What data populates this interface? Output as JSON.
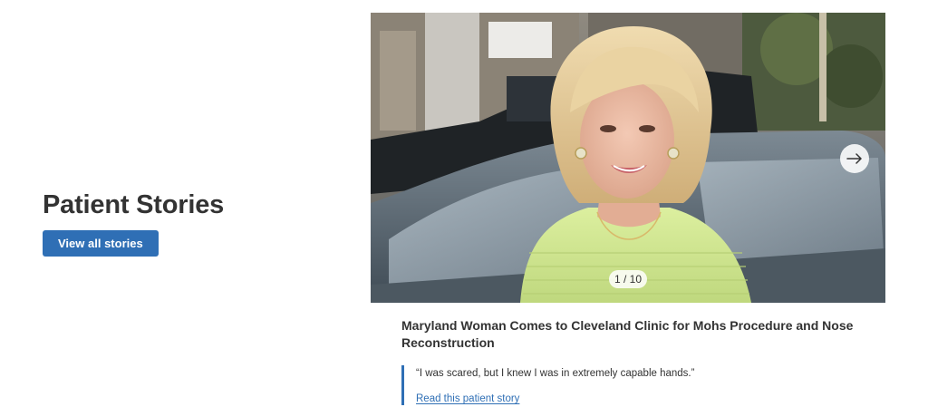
{
  "section": {
    "title": "Patient Stories",
    "view_all_label": "View all stories"
  },
  "carousel": {
    "counter": "1 / 10",
    "next_icon": "arrow-right-icon",
    "colors": {
      "accent": "#2f6fb5",
      "blouse": "#cfe58f",
      "hair": "#e6cf9c"
    }
  },
  "story": {
    "title": "Maryland Woman Comes to Cleveland Clinic for Mohs Procedure and Nose Reconstruction",
    "quote": "“I was scared, but I knew I was in extremely capable hands.”",
    "link_label": "Read this patient story"
  }
}
